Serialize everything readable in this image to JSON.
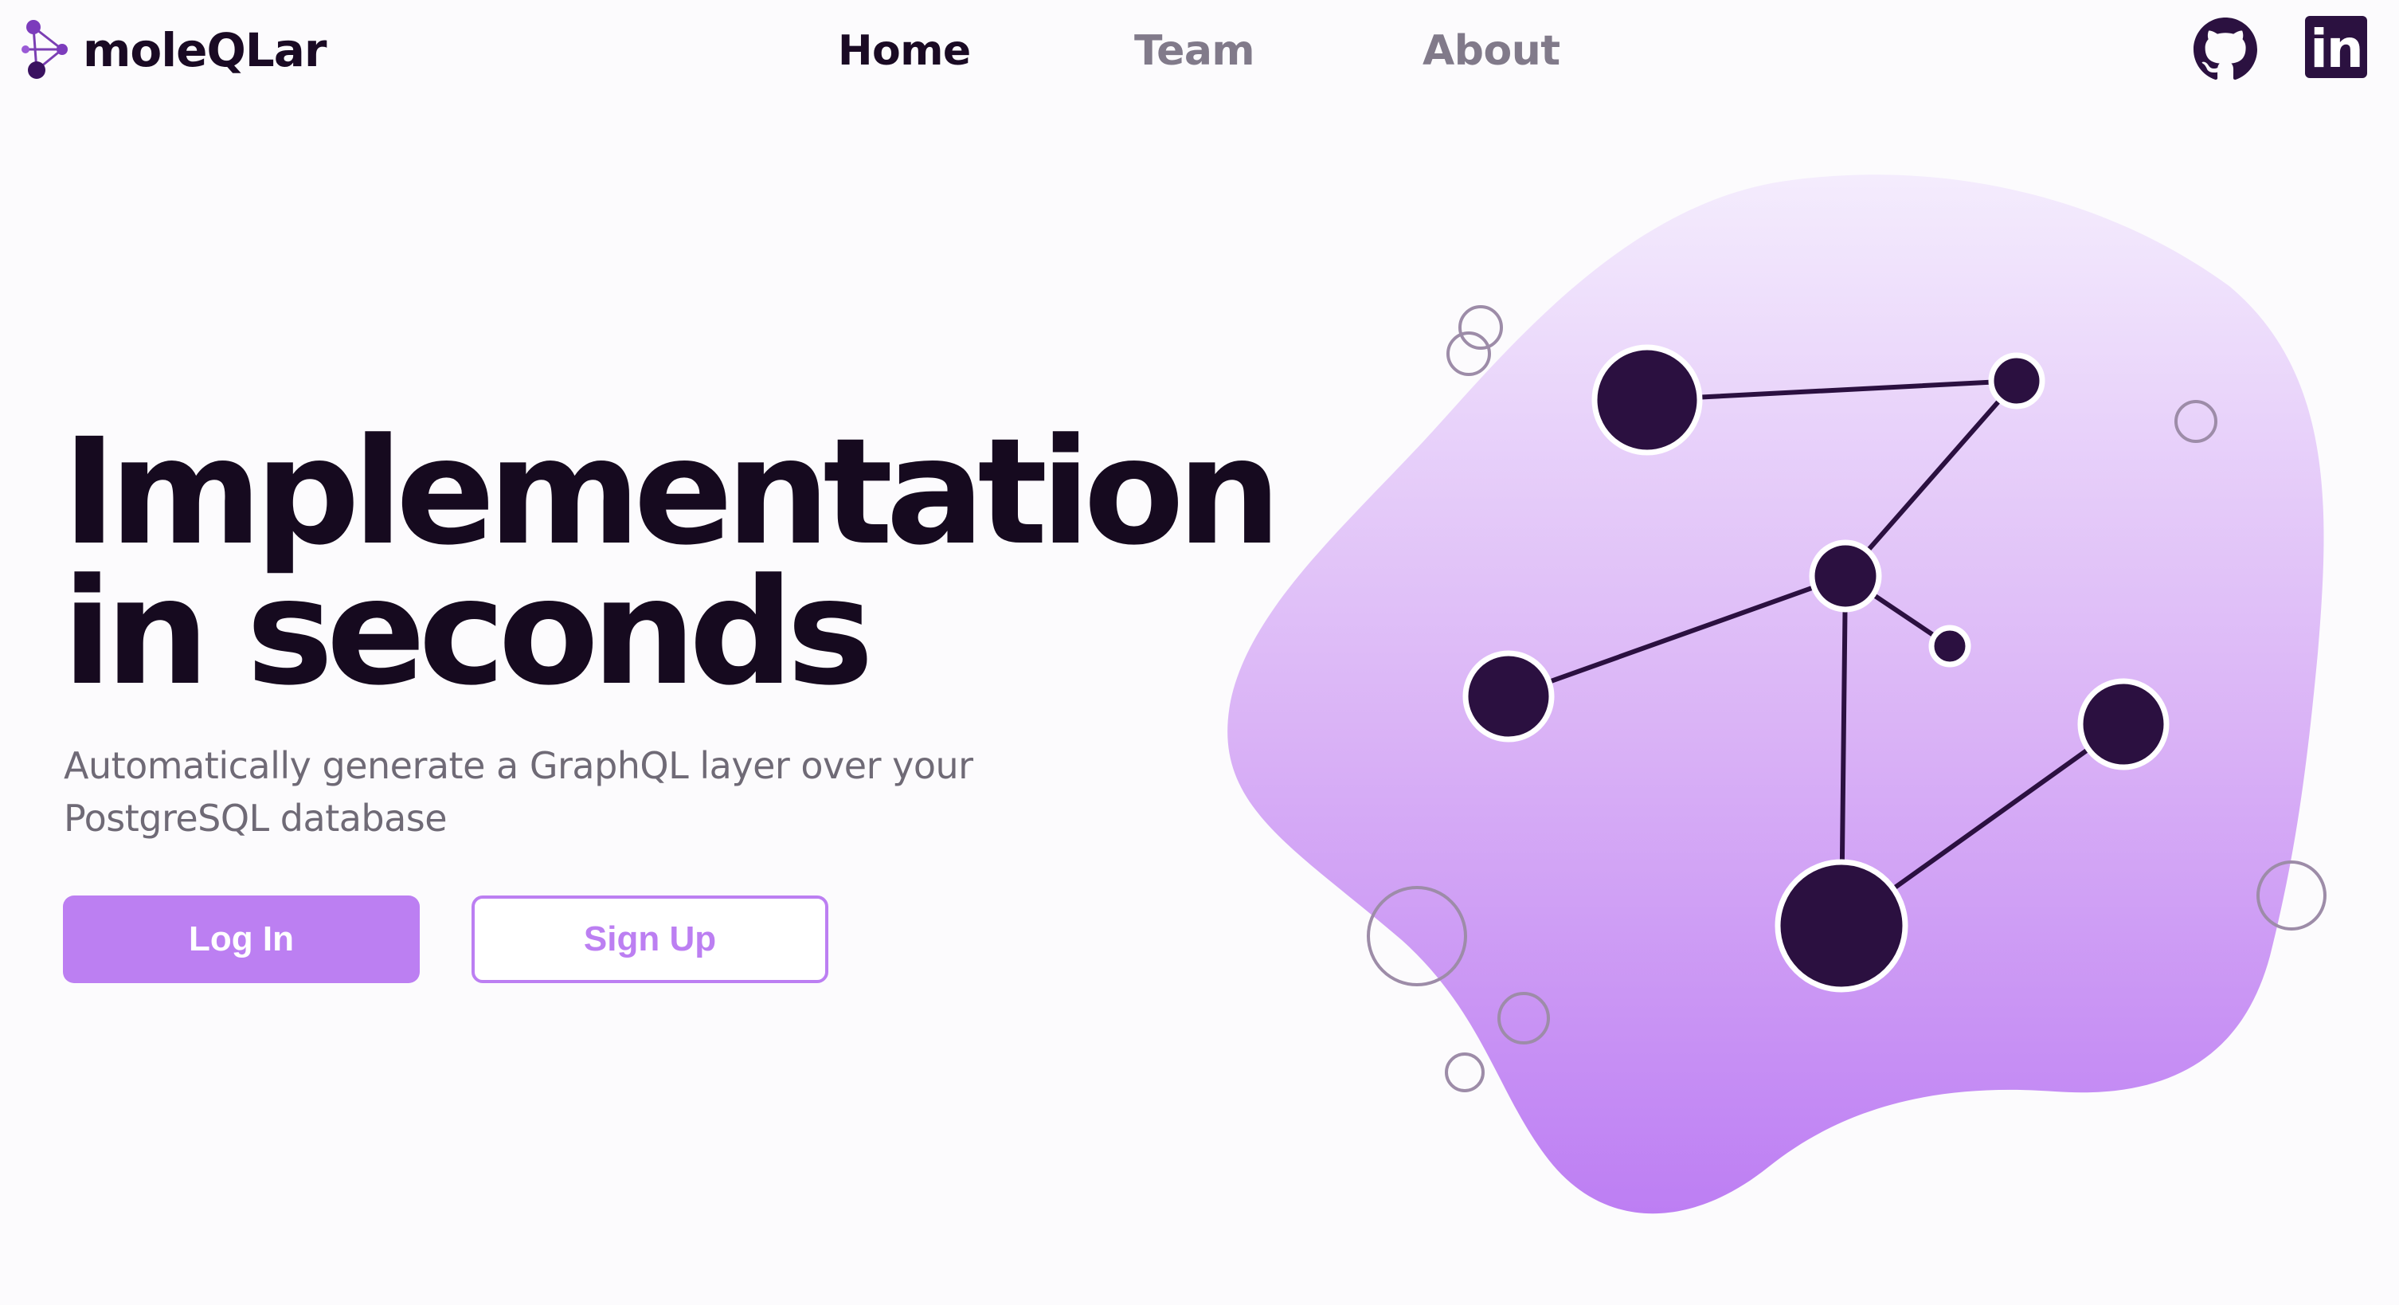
{
  "header": {
    "brand": "moleQLar",
    "nav": {
      "home": "Home",
      "team": "Team",
      "about": "About"
    },
    "linkedin_label": "in"
  },
  "hero": {
    "title_line1": "Implementation",
    "title_line2": "in seconds",
    "subtitle": "Automatically generate a GraphQL layer over your PostgreSQL database",
    "login_label": "Log In",
    "signup_label": "Sign Up"
  },
  "icons": {
    "logo": "molecule-logo-icon",
    "github": "github-icon",
    "linkedin": "linkedin-icon",
    "illustration": "molecule-graph-illustration"
  },
  "colors": {
    "accent": "#bc7ff2",
    "dark": "#1a0a24",
    "muted": "#817a8a",
    "node": "#2b1040",
    "blob_top": "#f4ecfd",
    "blob_bottom": "#bd7ef3"
  }
}
